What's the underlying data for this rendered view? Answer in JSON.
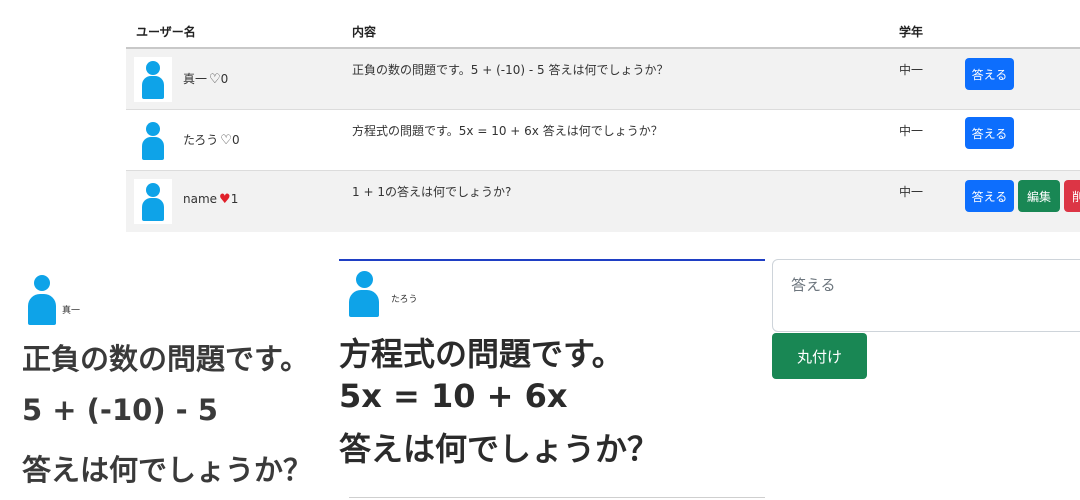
{
  "table": {
    "headers": {
      "username": "ユーザー名",
      "content": "内容",
      "grade": "学年"
    },
    "rows": [
      {
        "name": "真一",
        "likes": "0",
        "liked": false,
        "content": "正負の数の問題です。5 + (-10) - 5 答えは何でしょうか？",
        "grade": "中一",
        "answer_label": "答える"
      },
      {
        "name": "たろう",
        "likes": "0",
        "liked": false,
        "content": "方程式の問題です。5x = 10 + 6x 答えは何でしょうか？",
        "grade": "中一",
        "answer_label": "答える"
      },
      {
        "name": "name",
        "likes": "1",
        "liked": true,
        "content": "1 + 1の答えは何でしょうか?",
        "grade": "中一",
        "answer_label": "答える",
        "edit_label": "編集",
        "delete_label": "削"
      }
    ]
  },
  "left_detail": {
    "name": "真一",
    "lines": [
      "正負の数の問題です。",
      "5 + (-10) - 5",
      "答えは何でしょうか？"
    ]
  },
  "mid_detail": {
    "name": "たろう",
    "lines": [
      "方程式の問題です。",
      "5x = 10 + 6x",
      "答えは何でしょうか？"
    ]
  },
  "answer_form": {
    "placeholder": "答える",
    "submit_label": "丸付け"
  },
  "colors": {
    "avatar": "#0ea3e8",
    "primary": "#0d6efd",
    "success": "#198754",
    "danger": "#dc3545",
    "heart_red": "#e0202a"
  },
  "icons": {
    "avatar": "user-avatar-icon",
    "heart_empty": "heart-outline-icon",
    "heart_full": "heart-filled-icon"
  }
}
